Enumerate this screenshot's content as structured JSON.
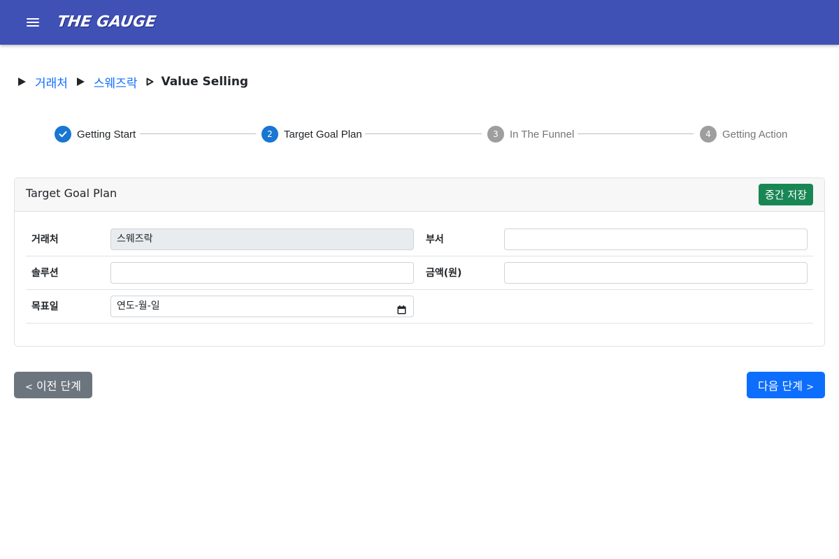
{
  "app": {
    "logo_text": "THE GAUGE",
    "brand_color": "#3f51b5",
    "menu_icon": "hamburger-menu-icon"
  },
  "breadcrumb": {
    "items": [
      {
        "label": "거래처"
      },
      {
        "label": "스웨즈락"
      }
    ],
    "current": "Value Selling"
  },
  "stepper": {
    "steps": [
      {
        "number": "",
        "label": "Getting Start",
        "status": "completed"
      },
      {
        "number": "2",
        "label": "Target Goal Plan",
        "status": "active"
      },
      {
        "number": "3",
        "label": "In The Funnel",
        "status": "inactive"
      },
      {
        "number": "4",
        "label": "Getting Action",
        "status": "inactive"
      }
    ],
    "active_color": "#1976d2",
    "inactive_color": "#9e9e9e"
  },
  "card": {
    "title": "Target Goal Plan",
    "save_button": "중간 저장",
    "save_color": "#198754",
    "fields": {
      "client_label": "거래처",
      "client_value": "스웨즈락",
      "department_label": "부서",
      "department_value": "",
      "solution_label": "솔루션",
      "solution_value": "",
      "amount_label": "금액(원)",
      "amount_value": "",
      "target_date_label": "목표일",
      "target_date_value": "연도-월-일"
    }
  },
  "nav": {
    "prev_chevron": "<",
    "prev_label": "이전 단계",
    "next_label": "다음 단계",
    "next_chevron": ">",
    "prev_color": "#6c757d",
    "next_color": "#0d6efd"
  }
}
